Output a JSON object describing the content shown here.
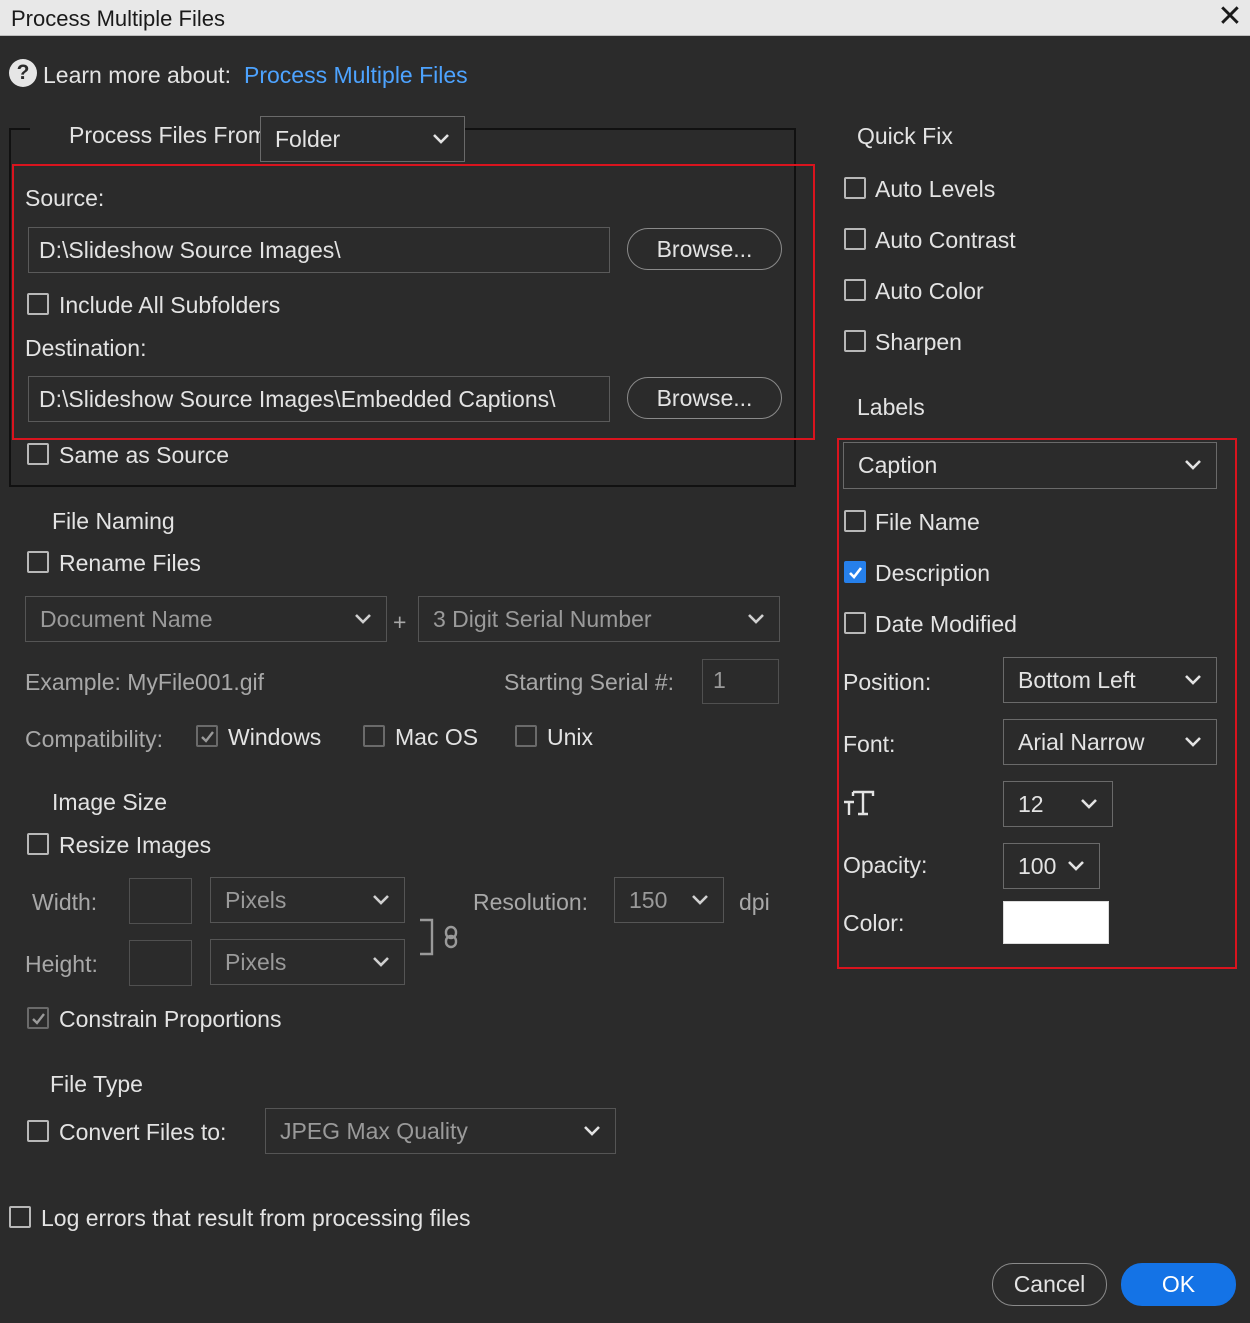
{
  "window": {
    "title": "Process Multiple Files",
    "close_glyph": "✕"
  },
  "help": {
    "icon": "help-circle-icon",
    "label": "Learn more about:",
    "link": "Process Multiple Files"
  },
  "process_from": {
    "label": "Process Files From:",
    "value": "Folder"
  },
  "source": {
    "label": "Source:",
    "path": "D:\\Slideshow Source Images\\",
    "browse": "Browse...",
    "include_subfolders": {
      "label": "Include All Subfolders",
      "checked": false
    }
  },
  "destination": {
    "label": "Destination:",
    "path": "D:\\Slideshow Source Images\\Embedded Captions\\",
    "browse": "Browse...",
    "same_as_source": {
      "label": "Same as Source",
      "checked": false
    }
  },
  "file_naming": {
    "heading": "File Naming",
    "rename": {
      "label": "Rename Files",
      "checked": false
    },
    "part1": "Document Name",
    "plus": "+",
    "part2": "3 Digit Serial Number",
    "example": "Example: MyFile001.gif",
    "serial_label": "Starting Serial #:",
    "serial_value": "1",
    "compat_label": "Compatibility:",
    "windows": {
      "label": "Windows",
      "checked": true
    },
    "macos": {
      "label": "Mac OS",
      "checked": false
    },
    "unix": {
      "label": "Unix",
      "checked": false
    }
  },
  "image_size": {
    "heading": "Image Size",
    "resize": {
      "label": "Resize Images",
      "checked": false
    },
    "width_label": "Width:",
    "height_label": "Height:",
    "width_unit": "Pixels",
    "height_unit": "Pixels",
    "resolution_label": "Resolution:",
    "resolution_value": "150",
    "dpi": "dpi",
    "constrain": {
      "label": "Constrain Proportions",
      "checked": true
    }
  },
  "file_type": {
    "heading": "File Type",
    "convert": {
      "label": "Convert Files to:",
      "checked": false
    },
    "format": "JPEG Max Quality"
  },
  "log_errors": {
    "label": "Log errors that result from processing files",
    "checked": false
  },
  "quick_fix": {
    "heading": "Quick Fix",
    "items": [
      {
        "label": "Auto Levels",
        "checked": false
      },
      {
        "label": "Auto Contrast",
        "checked": false
      },
      {
        "label": "Auto Color",
        "checked": false
      },
      {
        "label": "Sharpen",
        "checked": false
      }
    ]
  },
  "labels": {
    "heading": "Labels",
    "type": "Caption",
    "file_name": {
      "label": "File Name",
      "checked": false
    },
    "description": {
      "label": "Description",
      "checked": true
    },
    "date_modified": {
      "label": "Date Modified",
      "checked": false
    },
    "position_label": "Position:",
    "position_value": "Bottom Left",
    "font_label": "Font:",
    "font_value": "Arial Narrow",
    "size_icon": "text-size-icon",
    "size_value": "12",
    "opacity_label": "Opacity:",
    "opacity_value": "100",
    "color_label": "Color:",
    "color_value": "#ffffff"
  },
  "footer": {
    "cancel": "Cancel",
    "ok": "OK"
  },
  "colors": {
    "accent": "#1473e6",
    "highlight_box": "#d9141e",
    "link": "#4da3ff"
  }
}
